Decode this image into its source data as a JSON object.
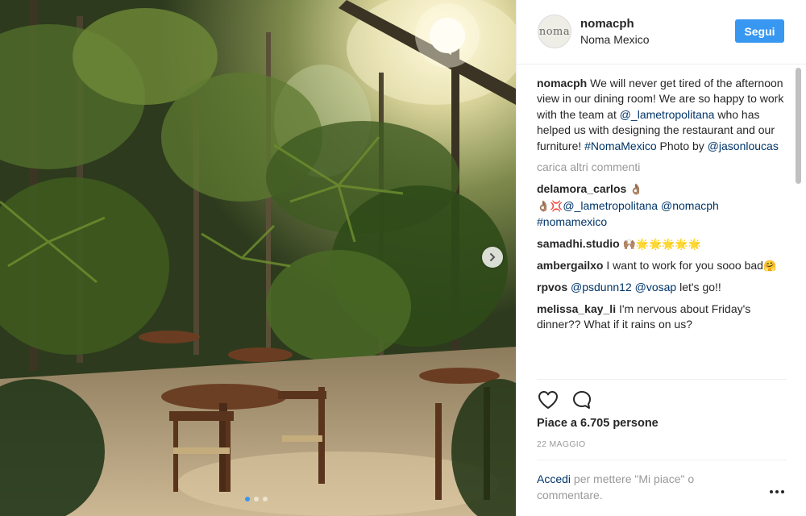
{
  "post": {
    "image_alt": "Outdoor dining area among tropical palm trees with wooden tables and chairs on sand",
    "carousel_total": 3,
    "carousel_active": 1
  },
  "header": {
    "avatar_text": "noma",
    "username": "nomacph",
    "location": "Noma Mexico",
    "follow_label": "Segui"
  },
  "caption": {
    "username": "nomacph",
    "text_1": " We will never get tired of the afternoon view in our dining room! We are so happy to work with the team at ",
    "mention_1": "@_lametropolitana",
    "text_2": " who has helped us with designing the restaurant and our furniture! ",
    "hashtag_1": "#NomaMexico",
    "text_3": " Photo by ",
    "mention_2": "@jasonloucas"
  },
  "load_more_label": "carica altri commenti",
  "comments": [
    {
      "username": "delamora_carlos",
      "pre": " ",
      "emoji_a": "👌🏽",
      "emoji_b": "👌🏽💢",
      "mention_a": "@_lametropolitana",
      "mention_b": "@nomacph",
      "hashtag": "#nomamexico"
    },
    {
      "username": "samadhi.studio",
      "emoji": "🙌🏽🌟🌟🌟🌟🌟"
    },
    {
      "username": "ambergailxo",
      "text": " I want to work for you sooo bad",
      "emoji": "🤗"
    },
    {
      "username": "rpvos",
      "mention_a": "@psdunn12",
      "mention_b": "@vosap",
      "text": " let's go!!"
    },
    {
      "username": "melissa_kay_li",
      "text": " I'm nervous about Friday's dinner?? What if it rains on us?"
    }
  ],
  "likes_label": "Piace a 6.705 persone",
  "date_label": "22 MAGGIO",
  "login": {
    "link": "Accedi",
    "text": " per mettere \"Mi piace\" o commentare."
  },
  "icons": {
    "like": "heart-icon",
    "comment": "comment-bubble-icon",
    "next": "chevron-right-icon",
    "more": "more-options-icon"
  },
  "colors": {
    "accent": "#3897f0",
    "link": "#003569",
    "muted": "#999999",
    "text": "#262626"
  }
}
